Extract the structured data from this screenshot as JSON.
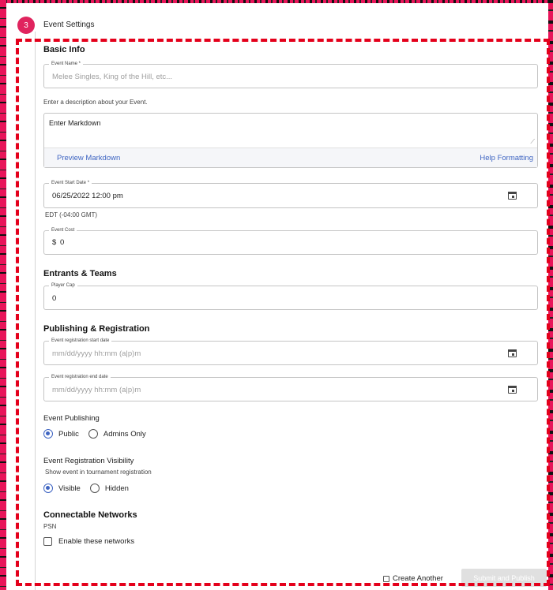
{
  "step": {
    "number": "3",
    "title": "Event Settings"
  },
  "basic_info": {
    "heading": "Basic Info",
    "event_name": {
      "label": "Event Name *",
      "placeholder": "Melee Singles, King of the Hill, etc..."
    },
    "description_hint": "Enter a description about your Event.",
    "markdown": {
      "placeholder": "Enter Markdown",
      "preview_label": "Preview Markdown",
      "help_label": "Help Formatting"
    },
    "start_date": {
      "label": "Event Start Date *",
      "value": "06/25/2022 12:00 pm",
      "icon": "calendar-icon"
    },
    "timezone": "EDT (-04:00 GMT)",
    "cost": {
      "label": "Event Cost",
      "currency": "$",
      "value": "0"
    }
  },
  "entrants": {
    "heading": "Entrants & Teams",
    "player_cap": {
      "label": "Player Cap",
      "value": "0"
    }
  },
  "publishing": {
    "heading": "Publishing & Registration",
    "reg_start": {
      "label": "Event registration start date",
      "placeholder": "mm/dd/yyyy hh:mm (a|p)m"
    },
    "reg_end": {
      "label": "Event registration end date",
      "placeholder": "mm/dd/yyyy hh:mm (a|p)m"
    },
    "event_publishing": {
      "label": "Event Publishing",
      "options": [
        "Public",
        "Admins Only"
      ],
      "selected": "Public"
    },
    "visibility": {
      "label": "Event Registration Visibility",
      "hint": "Show event in tournament registration",
      "options": [
        "Visible",
        "Hidden"
      ],
      "selected": "Visible"
    }
  },
  "networks": {
    "heading": "Connectable Networks",
    "network": "PSN",
    "enable_label": "Enable these networks"
  },
  "footer": {
    "create_another": "Create Another",
    "submit": "Submit and Publish"
  },
  "colors": {
    "accent": "#e0245e",
    "link": "#3f65c2",
    "dash": "#e4001b"
  }
}
